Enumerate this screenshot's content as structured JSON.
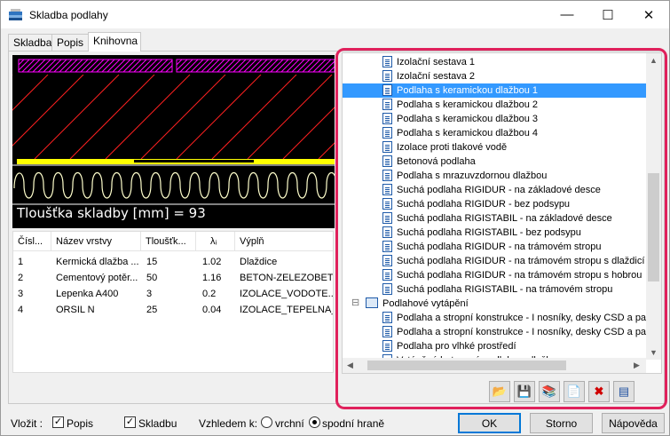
{
  "window": {
    "title": "Skladba podlahy",
    "minimize_glyph": "—",
    "maximize_glyph": "☐",
    "close_glyph": "✕"
  },
  "tabs": [
    {
      "label": "Skladba",
      "active": false
    },
    {
      "label": "Popis",
      "active": false
    },
    {
      "label": "Knihovna",
      "active": true
    }
  ],
  "preview": {
    "thickness_text": "Tloušťka skladby [mm] = 93"
  },
  "layers": {
    "columns": [
      "Čísl...",
      "Název vrstvy",
      "Tloušťk...",
      "λᵢ",
      "Výplň"
    ],
    "rows": [
      [
        "1",
        "Kermická dlažba ...",
        "15",
        "1.02",
        "Dlaždice"
      ],
      [
        "2",
        "Cementový potěr...",
        "50",
        "1.16",
        "BETON-ZELEZOBET..."
      ],
      [
        "3",
        "Lepenka A400",
        "3",
        "0.2",
        "IZOLACE_VODOTE..."
      ],
      [
        "4",
        "ORSIL N",
        "25",
        "0.04",
        "IZOLACE_TEPELNA_U"
      ]
    ]
  },
  "library": {
    "items": [
      {
        "label": "Izolační sestava 1",
        "type": "doc",
        "indent": 1
      },
      {
        "label": "Izolační sestava 2",
        "type": "doc",
        "indent": 1
      },
      {
        "label": "Podlaha s keramickou dlažbou 1",
        "type": "doc",
        "indent": 1,
        "selected": true
      },
      {
        "label": "Podlaha s keramickou dlažbou 2",
        "type": "doc",
        "indent": 1
      },
      {
        "label": "Podlaha s keramickou dlažbou 3",
        "type": "doc",
        "indent": 1
      },
      {
        "label": "Podlaha s keramickou dlažbou 4",
        "type": "doc",
        "indent": 1
      },
      {
        "label": "Izolace proti tlakové vodě",
        "type": "doc",
        "indent": 1
      },
      {
        "label": "Betonová podlaha",
        "type": "doc",
        "indent": 1
      },
      {
        "label": "Podlaha s mrazuvzdornou dlažbou",
        "type": "doc",
        "indent": 1
      },
      {
        "label": "Suchá podlaha RIGIDUR - na základové desce",
        "type": "doc",
        "indent": 1
      },
      {
        "label": "Suchá podlaha RIGIDUR - bez podsypu",
        "type": "doc",
        "indent": 1
      },
      {
        "label": "Suchá podlaha RIGISTABIL - na základové desce",
        "type": "doc",
        "indent": 1
      },
      {
        "label": "Suchá podlaha RIGISTABIL - bez podsypu",
        "type": "doc",
        "indent": 1
      },
      {
        "label": "Suchá podlaha RIGIDUR - na trámovém stropu",
        "type": "doc",
        "indent": 1
      },
      {
        "label": "Suchá podlaha RIGIDUR - na trámovém stropu s dlaždicí",
        "type": "doc",
        "indent": 1
      },
      {
        "label": "Suchá podlaha RIGIDUR - na trámovém stropu s hobrou",
        "type": "doc",
        "indent": 1
      },
      {
        "label": "Suchá podlaha RIGISTABIL - na trámovém stropu",
        "type": "doc",
        "indent": 1
      },
      {
        "label": "Podlahové vytápění",
        "type": "folder",
        "indent": 0,
        "toggle": "⊟"
      },
      {
        "label": "Podlaha a stropní konstrukce - I nosníky, desky  CSD a pat",
        "type": "doc",
        "indent": 1
      },
      {
        "label": "Podlaha a stropní konstrukce - I nosníky, desky  CSD a pat",
        "type": "doc",
        "indent": 1
      },
      {
        "label": "Podlaha pro vlhké prostředí",
        "type": "doc",
        "indent": 1
      },
      {
        "label": "Vytápěná betonová podlaha s dlažbou",
        "type": "doc",
        "indent": 1
      }
    ],
    "toolbar_icons": [
      "open-folder-icon",
      "save-icon",
      "library-icon",
      "new-document-icon",
      "delete-icon",
      "properties-icon"
    ],
    "toolbar_glyphs": [
      "📂",
      "💾",
      "📚",
      "📄",
      "✖",
      "▤"
    ]
  },
  "bottom": {
    "insert_label": "Vložit :",
    "popis_label": "Popis",
    "popis_checked": "✓",
    "skladbu_label": "Skladbu",
    "skladbu_checked": "✓",
    "view_label": "Vzhledem k:",
    "top_edge_label": "vrchní",
    "bottom_edge_label": "spodní hraně",
    "selected_edge": "spodní hraně",
    "ok_label": "OK",
    "cancel_label": "Storno",
    "help_label": "Nápověda"
  },
  "colors": {
    "selection": "#3399ff",
    "highlight_frame": "#e0215c",
    "hatch_red": "#ff2020",
    "yellow_layer": "#ffff00",
    "magenta_layer": "#ff00ff"
  }
}
